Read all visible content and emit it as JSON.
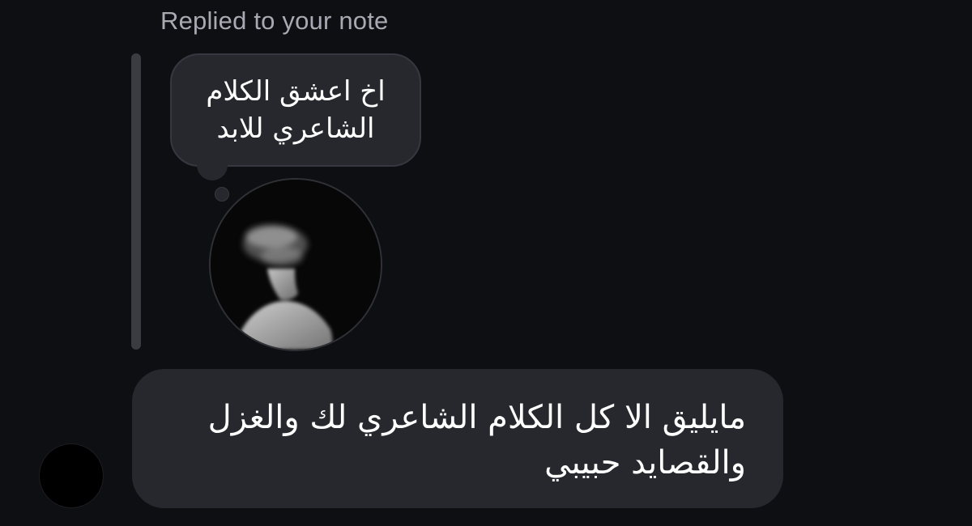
{
  "reply_context": {
    "header": "Replied to your note",
    "note_text": "اخ اعشق الكلام الشاعري للابد",
    "note_avatar_icon": "blurred-portrait-image"
  },
  "message": {
    "text": "مايليق الا كل الكلام الشاعري لك والغزل والقصايد حبيبي"
  },
  "sender": {
    "avatar_icon": "profile-avatar"
  },
  "colors": {
    "background": "#0e0f13",
    "bubble": "#26282d",
    "header_text": "#a7aab2",
    "text": "#ffffff"
  }
}
